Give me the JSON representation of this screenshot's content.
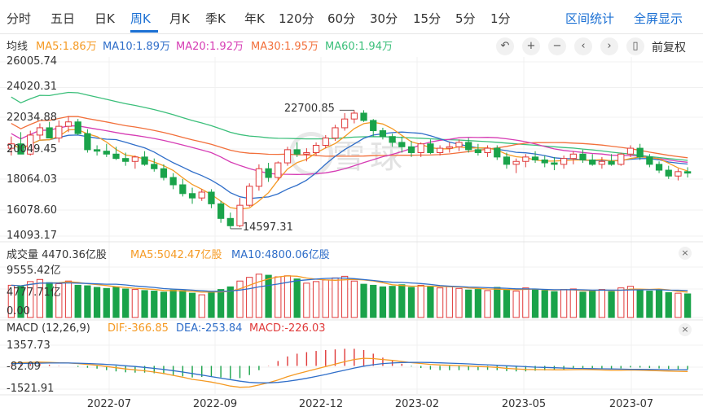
{
  "tabs": [
    "分时",
    "五日",
    "日K",
    "周K",
    "月K",
    "季K",
    "年K",
    "120分",
    "60分",
    "30分",
    "15分",
    "5分",
    "1分"
  ],
  "active_tab": "周K",
  "right_links": [
    "区间统计",
    "全屏显示"
  ],
  "ma_legend": {
    "title": "均线",
    "items": [
      {
        "label": "MA5:1.86万",
        "color": "#f59a23"
      },
      {
        "label": "MA10:1.89万",
        "color": "#2f6ec9"
      },
      {
        "label": "MA20:1.92万",
        "color": "#d63cb4"
      },
      {
        "label": "MA30:1.95万",
        "color": "#f26f3a"
      },
      {
        "label": "MA60:1.94万",
        "color": "#3bbf7a"
      }
    ]
  },
  "toolbar": {
    "icons": [
      "undo-icon",
      "zoom-in-icon",
      "zoom-out-icon",
      "scroll-left-icon",
      "scroll-right-icon",
      "candle-mode-icon"
    ],
    "glyphs": [
      "↶",
      "+",
      "−",
      "‹",
      "›",
      "▯"
    ],
    "adjust_label": "前复权"
  },
  "price_axis": [
    "26005.74",
    "24020.31",
    "22034.88",
    "20049.45",
    "18064.03",
    "16078.60",
    "14093.17"
  ],
  "annotations": {
    "high": "22700.85",
    "low": "14597.31"
  },
  "volume_legend": {
    "title": "成交量 4470.36亿股",
    "items": [
      {
        "label": "MA5:5042.47亿股",
        "color": "#f59a23"
      },
      {
        "label": "MA10:4800.06亿股",
        "color": "#2f6ec9"
      }
    ]
  },
  "volume_axis": [
    "9555.42亿",
    "4777.71亿",
    "0.00"
  ],
  "macd_legend": {
    "title": "MACD (12,26,9)",
    "items": [
      {
        "label": "DIF:-366.85",
        "color": "#f59a23"
      },
      {
        "label": "DEA:-253.84",
        "color": "#2f6ec9"
      },
      {
        "label": "MACD:-226.03",
        "color": "#e03a3a"
      }
    ]
  },
  "macd_axis": [
    "1357.73",
    "-82.09",
    "-1521.91"
  ],
  "date_labels": [
    "2022-07",
    "2022-09",
    "2022-12",
    "2023-02",
    "2023-05",
    "2023-07"
  ],
  "colors": {
    "up": "#e03a3a",
    "down": "#1aa34a",
    "accent": "#1a6fd3"
  },
  "watermark": "雪球",
  "chart_data": {
    "type": "candlestick",
    "period": "weekly",
    "x": [
      "2022-05-20",
      "2022-05-27",
      "2022-06-03",
      "2022-06-10",
      "2022-06-17",
      "2022-06-24",
      "2022-07-01",
      "2022-07-08",
      "2022-07-15",
      "2022-07-22",
      "2022-07-29",
      "2022-08-05",
      "2022-08-12",
      "2022-08-19",
      "2022-08-26",
      "2022-09-02",
      "2022-09-09",
      "2022-09-16",
      "2022-09-23",
      "2022-09-30",
      "2022-10-07",
      "2022-10-14",
      "2022-10-21",
      "2022-10-28",
      "2022-11-04",
      "2022-11-11",
      "2022-11-18",
      "2022-11-25",
      "2022-12-02",
      "2022-12-09",
      "2022-12-16",
      "2022-12-23",
      "2022-12-30",
      "2023-01-06",
      "2023-01-13",
      "2023-01-20",
      "2023-01-27",
      "2023-02-03",
      "2023-02-10",
      "2023-02-17",
      "2023-02-24",
      "2023-03-03",
      "2023-03-10",
      "2023-03-17",
      "2023-03-24",
      "2023-03-31",
      "2023-04-07",
      "2023-04-14",
      "2023-04-21",
      "2023-04-28",
      "2023-05-05",
      "2023-05-12",
      "2023-05-19",
      "2023-05-26",
      "2023-06-02",
      "2023-06-09",
      "2023-06-16",
      "2023-06-23",
      "2023-06-30",
      "2023-07-07",
      "2023-07-14",
      "2023-07-21",
      "2023-07-28",
      "2023-08-04",
      "2023-08-11",
      "2023-08-18",
      "2023-08-25",
      "2023-09-01",
      "2023-09-08",
      "2023-09-15",
      "2023-09-22",
      "2023-09-29"
    ],
    "ohlc": [
      [
        20100,
        20900,
        19600,
        20400
      ],
      [
        20400,
        21200,
        19800,
        19700
      ],
      [
        19700,
        21300,
        19600,
        21000
      ],
      [
        21000,
        21800,
        20700,
        21500
      ],
      [
        21500,
        21900,
        20800,
        20800
      ],
      [
        20800,
        22000,
        20500,
        21600
      ],
      [
        21600,
        22300,
        21200,
        21900
      ],
      [
        21900,
        22100,
        21000,
        21100
      ],
      [
        21100,
        21400,
        19800,
        20000
      ],
      [
        20000,
        20300,
        19600,
        19900
      ],
      [
        19900,
        20400,
        19500,
        19700
      ],
      [
        19700,
        20200,
        19300,
        19400
      ],
      [
        19400,
        19800,
        18900,
        19200
      ],
      [
        19200,
        19600,
        18700,
        19500
      ],
      [
        19500,
        19900,
        18900,
        19000
      ],
      [
        19000,
        19400,
        18500,
        18700
      ],
      [
        18700,
        19000,
        17900,
        18100
      ],
      [
        18100,
        18400,
        17300,
        17600
      ],
      [
        17600,
        18000,
        16800,
        17000
      ],
      [
        17000,
        17400,
        16300,
        16700
      ],
      [
        16700,
        17300,
        16500,
        17100
      ],
      [
        17100,
        17300,
        16000,
        16300
      ],
      [
        16300,
        16500,
        15000,
        15300
      ],
      [
        15300,
        15700,
        14597,
        14800
      ],
      [
        14800,
        16700,
        14700,
        16200
      ],
      [
        16200,
        17700,
        16100,
        17500
      ],
      [
        17500,
        19000,
        17200,
        18700
      ],
      [
        18700,
        19100,
        17800,
        18100
      ],
      [
        18100,
        19200,
        17900,
        19100
      ],
      [
        19100,
        20200,
        18900,
        20000
      ],
      [
        20000,
        20500,
        19500,
        19700
      ],
      [
        19700,
        20100,
        19200,
        19800
      ],
      [
        19800,
        20500,
        19600,
        20300
      ],
      [
        20300,
        21000,
        20100,
        20800
      ],
      [
        20800,
        21700,
        20600,
        21500
      ],
      [
        21500,
        22500,
        21300,
        22100
      ],
      [
        22100,
        22700,
        21800,
        22500
      ],
      [
        22500,
        22700,
        21900,
        22000
      ],
      [
        22000,
        22100,
        20900,
        21300
      ],
      [
        21300,
        21500,
        20700,
        20900
      ],
      [
        20900,
        21100,
        20200,
        20500
      ],
      [
        20500,
        20900,
        19800,
        20200
      ],
      [
        20200,
        20600,
        19500,
        19800
      ],
      [
        19800,
        20500,
        19500,
        20400
      ],
      [
        20400,
        20700,
        19700,
        19800
      ],
      [
        19800,
        20300,
        19600,
        20100
      ],
      [
        20100,
        20500,
        19800,
        20200
      ],
      [
        20200,
        20700,
        19900,
        20500
      ],
      [
        20500,
        20800,
        19800,
        20000
      ],
      [
        20000,
        20400,
        19600,
        19800
      ],
      [
        19800,
        20300,
        19500,
        20100
      ],
      [
        20100,
        20300,
        19300,
        19500
      ],
      [
        19500,
        19800,
        18700,
        19000
      ],
      [
        19000,
        19400,
        18400,
        19200
      ],
      [
        19200,
        19700,
        18800,
        19500
      ],
      [
        19500,
        19900,
        19100,
        19300
      ],
      [
        19300,
        19600,
        18800,
        19100
      ],
      [
        19100,
        19500,
        18600,
        19000
      ],
      [
        19000,
        19600,
        18700,
        19400
      ],
      [
        19400,
        19900,
        19000,
        19700
      ],
      [
        19700,
        20000,
        19100,
        19300
      ],
      [
        19300,
        19700,
        18900,
        19000
      ],
      [
        19000,
        19500,
        18700,
        19200
      ],
      [
        19200,
        19700,
        18900,
        19000
      ],
      [
        19000,
        19800,
        18900,
        19700
      ],
      [
        19700,
        20300,
        19500,
        20100
      ],
      [
        20100,
        20400,
        19300,
        19500
      ],
      [
        19500,
        19700,
        18800,
        19000
      ],
      [
        19000,
        19200,
        18400,
        18600
      ],
      [
        18600,
        18900,
        18000,
        18200
      ],
      [
        18200,
        18700,
        17900,
        18500
      ],
      [
        18500,
        18800,
        18100,
        18400
      ]
    ],
    "volume": [
      6100,
      5900,
      6800,
      7200,
      6600,
      6400,
      6900,
      6100,
      6000,
      5700,
      5500,
      5800,
      5400,
      5300,
      5100,
      5000,
      4800,
      5200,
      5100,
      4600,
      4300,
      4900,
      5300,
      5800,
      6900,
      7600,
      8200,
      8000,
      7700,
      7900,
      7300,
      6500,
      6800,
      7100,
      7500,
      7800,
      6900,
      6300,
      6100,
      5800,
      5900,
      6200,
      5700,
      6100,
      5800,
      5600,
      5900,
      5500,
      5200,
      5300,
      5100,
      5700,
      5200,
      5000,
      5600,
      5400,
      5100,
      4900,
      5300,
      5400,
      4800,
      5100,
      5300,
      4900,
      5600,
      5900,
      5200,
      5000,
      5300,
      4700,
      4600,
      4470
    ],
    "macd": {
      "dif": [
        180,
        210,
        230,
        250,
        230,
        200,
        190,
        150,
        100,
        40,
        -40,
        -120,
        -200,
        -260,
        -320,
        -400,
        -500,
        -620,
        -740,
        -880,
        -960,
        -1060,
        -1180,
        -1320,
        -1400,
        -1380,
        -1250,
        -1100,
        -920,
        -700,
        -520,
        -360,
        -200,
        -40,
        120,
        280,
        420,
        500,
        480,
        420,
        360,
        290,
        210,
        160,
        100,
        60,
        40,
        20,
        -10,
        -40,
        -60,
        -100,
        -160,
        -200,
        -230,
        -240,
        -250,
        -260,
        -260,
        -250,
        -240,
        -250,
        -270,
        -290,
        -290,
        -270,
        -280,
        -300,
        -320,
        -340,
        -355,
        -366.85
      ],
      "dea": [
        150,
        160,
        170,
        180,
        190,
        190,
        190,
        180,
        160,
        130,
        100,
        60,
        10,
        -40,
        -100,
        -160,
        -230,
        -310,
        -400,
        -500,
        -600,
        -700,
        -800,
        -900,
        -1000,
        -1080,
        -1110,
        -1110,
        -1080,
        -1010,
        -920,
        -810,
        -690,
        -560,
        -420,
        -280,
        -140,
        -20,
        80,
        150,
        190,
        220,
        230,
        230,
        220,
        200,
        180,
        160,
        130,
        100,
        70,
        40,
        10,
        -20,
        -50,
        -80,
        -100,
        -120,
        -140,
        -160,
        -170,
        -180,
        -190,
        -200,
        -210,
        -220,
        -225,
        -230,
        -238,
        -245,
        -250,
        -253.84
      ],
      "hist": [
        60,
        100,
        120,
        140,
        80,
        20,
        0,
        -60,
        -120,
        -180,
        -280,
        -360,
        -420,
        -440,
        -440,
        -480,
        -540,
        -620,
        -680,
        -760,
        -720,
        -720,
        -760,
        -840,
        -800,
        -600,
        -280,
        20,
        320,
        620,
        800,
        900,
        980,
        1040,
        1080,
        1120,
        1120,
        1040,
        800,
        540,
        340,
        140,
        -40,
        -140,
        -240,
        -280,
        -280,
        -280,
        -280,
        -280,
        -260,
        -280,
        -340,
        -360,
        -360,
        -320,
        -300,
        -280,
        -240,
        -180,
        -140,
        -140,
        -160,
        -180,
        -160,
        -100,
        -110,
        -140,
        -164,
        -190,
        -210,
        -226.03
      ]
    },
    "price_axis_range": [
      14093.17,
      26005.74
    ],
    "volume_axis_range": [
      0,
      9555.42
    ],
    "macd_axis_range": [
      -1521.91,
      1357.73
    ]
  }
}
